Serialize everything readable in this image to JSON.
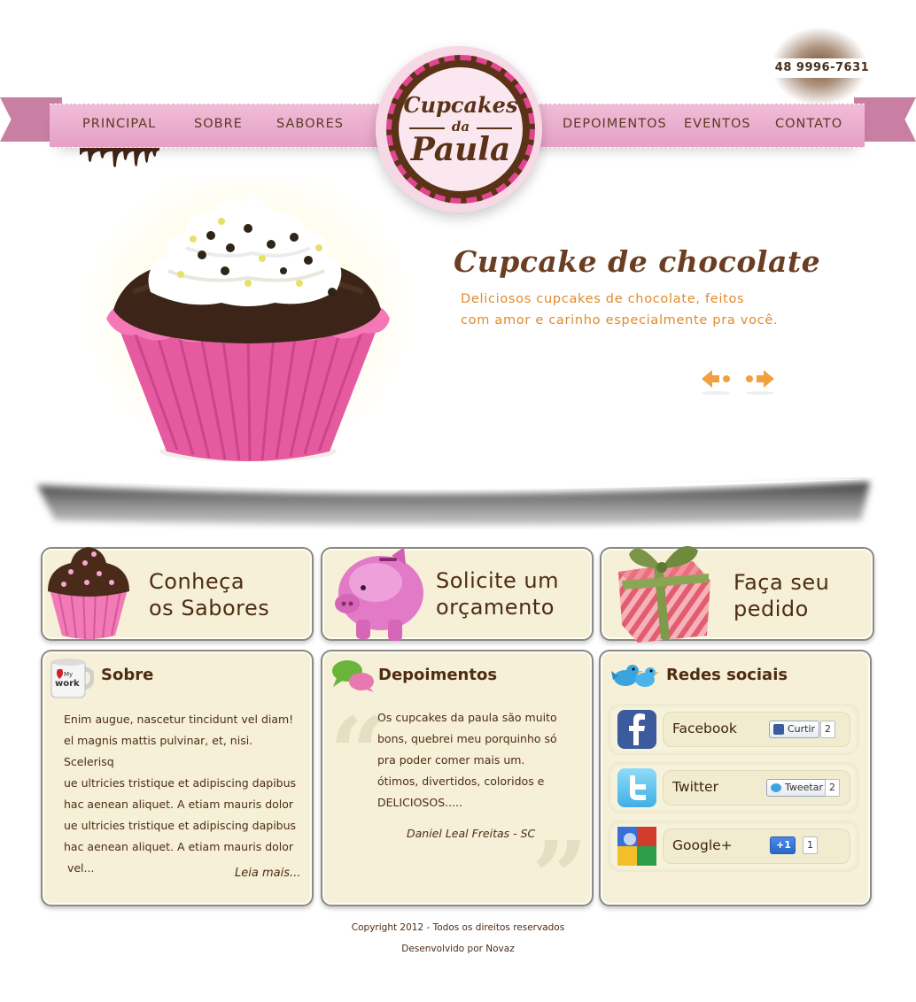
{
  "header": {
    "phone": "48 9996-7631",
    "logo": {
      "line1": "Cupcakes",
      "line2": "da",
      "line3": "Paula"
    },
    "nav": [
      {
        "label": "PRINCIPAL"
      },
      {
        "label": "SOBRE"
      },
      {
        "label": "SABORES"
      },
      {
        "label": "DEPOIMENTOS"
      },
      {
        "label": "EVENTOS"
      },
      {
        "label": "CONTATO"
      }
    ]
  },
  "hero": {
    "title": "Cupcake de chocolate",
    "description_line1": "Deliciosos cupcakes de chocolate, feitos",
    "description_line2": "com amor e carinho especialmente pra você."
  },
  "cta": [
    {
      "line1": "Conheça",
      "line2": "os Sabores"
    },
    {
      "line1": "Solicite um",
      "line2": "orçamento"
    },
    {
      "line1": "Faça seu",
      "line2": "pedido"
    }
  ],
  "about": {
    "title": "Sobre",
    "mug_text": "I My work",
    "lines": [
      "Enim augue, nascetur tincidunt vel diam!",
      "el magnis mattis pulvinar, et, nisi. Scelerisq",
      "ue ultricies tristique et adipiscing dapibus",
      "hac aenean aliquet. A etiam mauris dolor",
      "ue ultricies tristique et adipiscing dapibus",
      "hac aenean aliquet. A etiam mauris dolor",
      " vel..."
    ],
    "more": "Leia mais..."
  },
  "testimonials": {
    "title": "Depoimentos",
    "lines": [
      "Os cupcakes da paula são muito",
      "bons, quebrei meu porquinho só",
      "pra poder comer mais um.",
      "ótimos, divertidos, coloridos e",
      "DELICIOSOS....."
    ],
    "author": "Daniel Leal Freitas - SC"
  },
  "social": {
    "title": "Redes sociais",
    "items": [
      {
        "label": "Facebook",
        "button": "Curtir",
        "count": "2"
      },
      {
        "label": "Twitter",
        "button": "Tweetar",
        "count": "2"
      },
      {
        "label": "Google+",
        "button": "+1",
        "count": "1"
      }
    ]
  },
  "footer": {
    "copyright": "Copyright 2012 - Todos os direitos reservados",
    "credit": "Desenvolvido por Novaz"
  },
  "colors": {
    "ribbon_pink": "#e6a0c5",
    "brown": "#5a3218",
    "orange": "#e08a2c",
    "box_bg": "#f5f0d7"
  }
}
